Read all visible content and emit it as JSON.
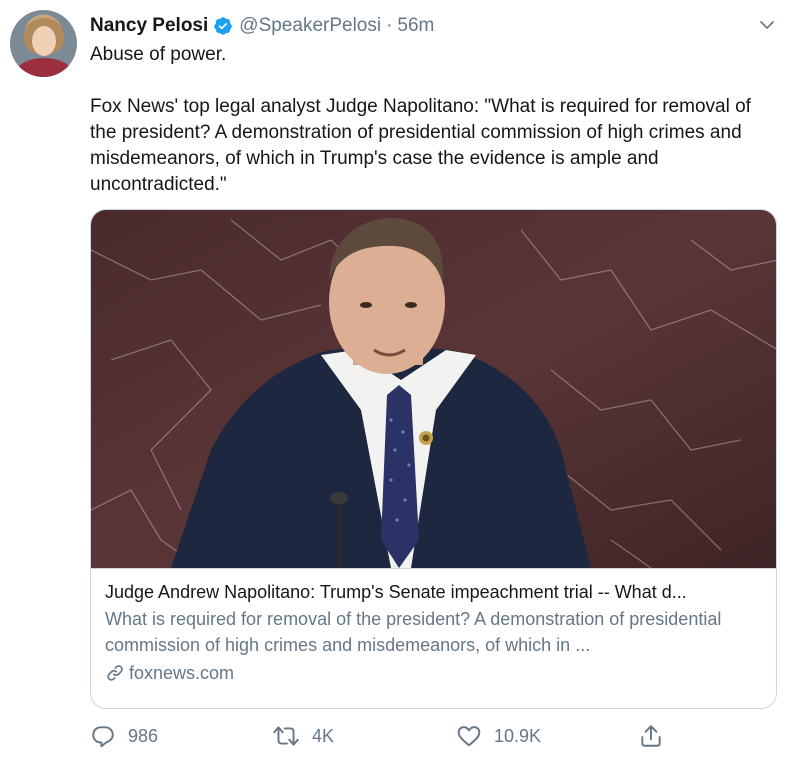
{
  "author": {
    "name": "Nancy Pelosi",
    "handle": "@SpeakerPelosi",
    "separator": "·",
    "time": "56m",
    "verified_icon": "verified-badge-icon",
    "accent_color": "#1da1f2"
  },
  "tweet": {
    "line1": "Abuse of power.",
    "line2": "Fox News' top legal analyst Judge Napolitano: \"What is required for removal of the president? A demonstration of presidential commission of high crimes and misdemeanors, of which in Trump's case the evidence is ample and uncontradicted.\""
  },
  "card": {
    "title": "Judge Andrew Napolitano: Trump's Senate impeachment trial -- What d...",
    "description": "What is required for removal of the president? A demonstration of presidential commission of high crimes and misdemeanors, of which in ...",
    "domain": "foxnews.com",
    "image_description_icon": "photo-of-speaker-at-podium"
  },
  "actions": {
    "reply_count": "986",
    "retweet_count": "4K",
    "like_count": "10.9K"
  },
  "colors": {
    "text": "#14171a",
    "secondary": "#657786",
    "border": "#ccd6dd"
  }
}
